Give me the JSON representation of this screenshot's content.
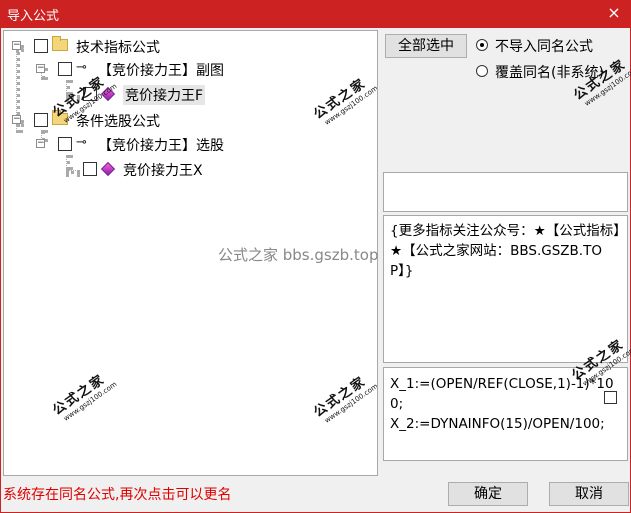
{
  "window": {
    "title": "导入公式",
    "close_glyph": "×"
  },
  "tree": {
    "nodes": [
      {
        "label": "技术指标公式",
        "expander": "−",
        "kind": "folder"
      },
      {
        "label": "【竞价接力王】副图",
        "expander": "−",
        "kind": "key"
      },
      {
        "label": "竞价接力王F",
        "kind": "formula",
        "selected": true
      },
      {
        "label": "条件选股公式",
        "expander": "−",
        "kind": "folder"
      },
      {
        "label": "【竞价接力王】选股",
        "expander": "−",
        "kind": "key"
      },
      {
        "label": "竞价接力王X",
        "kind": "formula"
      }
    ]
  },
  "buttons": {
    "select_all": "全部选中",
    "ok": "确定",
    "cancel": "取消"
  },
  "options": {
    "skip_same_name": "不导入同名公式",
    "overwrite_same_name": "覆盖同名(非系统)",
    "selected": "skip_same_name"
  },
  "description": "{更多指标关注公众号：★【公式指标】★【公式之家网站：BBS.GSZB.TOP】}",
  "formula_preview": [
    "X_1:=(OPEN/REF(CLOSE,1)-1)*100;",
    "X_2:=DYNAINFO(15)/OPEN/100;"
  ],
  "status_message": "系统存在同名公式,再次点击可以更名",
  "watermark": {
    "site_name": "公式之家",
    "url": "www.gszj100.com",
    "center_text": "公式之家 bbs.gszb.top"
  },
  "colors": {
    "title_bar": "#cc2222",
    "status_text": "#e00000"
  },
  "icons": {
    "folder": "folder-icon",
    "key": "key-icon",
    "formula": "diamond-icon",
    "close": "close-icon"
  }
}
